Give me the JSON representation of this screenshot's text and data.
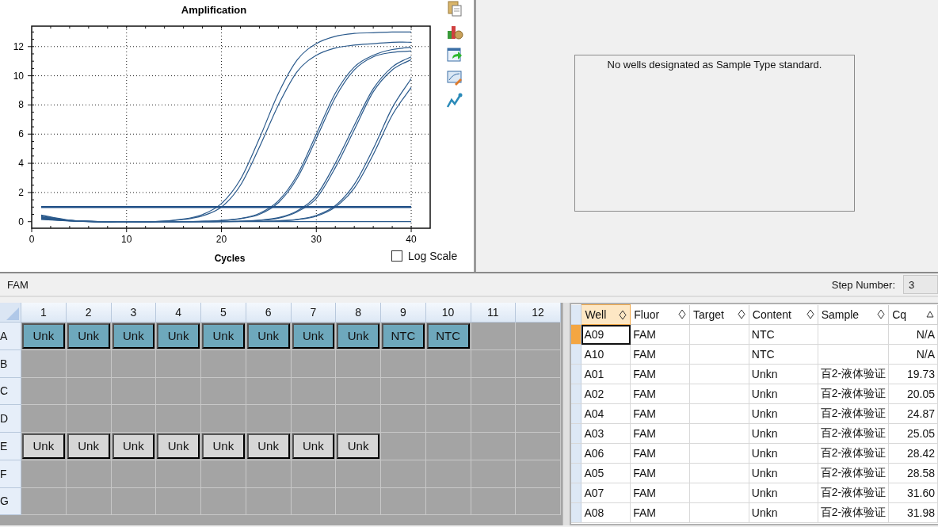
{
  "chart_panel": {
    "chart_data": {
      "type": "line",
      "title": "Amplification",
      "grid": true,
      "xlabel": "Cycles",
      "x": [
        1,
        4,
        7,
        10,
        13,
        16,
        18,
        20,
        22,
        24,
        26,
        28,
        30,
        32,
        34,
        36,
        38,
        40
      ],
      "xlim": [
        0,
        42
      ],
      "ylim": [
        -0.45,
        13.4
      ],
      "xticks": [
        0,
        10,
        20,
        30,
        40
      ],
      "yticks": [
        0,
        2,
        4,
        6,
        8,
        10,
        12
      ],
      "series": [
        {
          "color": "#2b5a8c",
          "values": [
            0.45,
            0.1,
            0,
            0,
            0,
            0.18,
            0.49,
            1.24,
            2.9,
            5.7,
            8.8,
            11.1,
            12.2,
            12.7,
            12.9,
            12.95,
            13,
            13
          ]
        },
        {
          "color": "#2b5a8c",
          "values": [
            0.4,
            0.08,
            0,
            0,
            0,
            0.15,
            0.4,
            1.0,
            2.5,
            5.1,
            8.0,
            10.3,
            11.4,
            11.9,
            12.1,
            12.2,
            12.3,
            12.3
          ]
        },
        {
          "color": "#2b5a8c",
          "values": [
            0.35,
            0.08,
            0,
            0,
            0,
            0,
            0.03,
            0.08,
            0.22,
            0.57,
            1.43,
            3.2,
            6.0,
            8.8,
            10.6,
            11.4,
            11.8,
            11.95
          ]
        },
        {
          "color": "#2b5a8c",
          "values": [
            0.3,
            0.07,
            0,
            0,
            0,
            0,
            0.02,
            0.07,
            0.2,
            0.5,
            1.3,
            3.0,
            5.7,
            8.5,
            10.4,
            11.3,
            11.6,
            11.7
          ]
        },
        {
          "color": "#2b5a8c",
          "values": [
            0.27,
            0.08,
            0,
            0,
            0,
            0,
            0,
            0.01,
            0.04,
            0.1,
            0.27,
            0.75,
            1.8,
            4.0,
            6.6,
            9.1,
            10.6,
            11.3
          ]
        },
        {
          "color": "#2b5a8c",
          "values": [
            0.24,
            0.06,
            0,
            0,
            0,
            0,
            0,
            0.01,
            0.03,
            0.09,
            0.24,
            0.68,
            1.6,
            3.7,
            6.3,
            8.9,
            10.4,
            11.1
          ]
        },
        {
          "color": "#2b5a8c",
          "values": [
            0.21,
            0.07,
            0,
            0,
            0,
            0,
            0,
            0,
            0.01,
            0.02,
            0.06,
            0.16,
            0.43,
            1.1,
            2.56,
            5.0,
            7.8,
            9.8
          ]
        },
        {
          "color": "#2b5a8c",
          "values": [
            0.18,
            0.06,
            0,
            0,
            0,
            0,
            0,
            0,
            0.01,
            0.02,
            0.05,
            0.14,
            0.38,
            1.0,
            2.3,
            4.6,
            7.3,
            9.2
          ]
        },
        {
          "color": "#2b5a8c",
          "values": [
            0.15,
            0.05,
            0,
            0,
            0,
            0,
            0,
            0,
            0,
            0,
            0,
            0,
            0,
            0,
            0,
            0,
            0,
            0
          ]
        }
      ],
      "ref_lines": [
        {
          "axis": "y",
          "value": 1
        }
      ]
    },
    "log_scale": {
      "label": "Log Scale",
      "checked": false
    }
  },
  "standard_curve_panel": {
    "message": "No wells designated as Sample Type standard."
  },
  "fluor_bar": {
    "fluor": "FAM",
    "step_label": "Step Number:",
    "step_value": "3"
  },
  "plate": {
    "columns": [
      "1",
      "2",
      "3",
      "4",
      "5",
      "6",
      "7",
      "8",
      "9",
      "10",
      "11",
      "12"
    ],
    "rows": [
      {
        "label": "A",
        "wells": [
          {
            "kind": "sample",
            "text": "Unk",
            "selected": true
          },
          {
            "kind": "sample",
            "text": "Unk",
            "selected": true
          },
          {
            "kind": "sample",
            "text": "Unk",
            "selected": true
          },
          {
            "kind": "sample",
            "text": "Unk",
            "selected": true
          },
          {
            "kind": "sample",
            "text": "Unk",
            "selected": true
          },
          {
            "kind": "sample",
            "text": "Unk",
            "selected": true
          },
          {
            "kind": "sample",
            "text": "Unk",
            "selected": true
          },
          {
            "kind": "sample",
            "text": "Unk",
            "selected": true
          },
          {
            "kind": "sample",
            "text": "NTC",
            "selected": true
          },
          {
            "kind": "sample",
            "text": "NTC",
            "selected": true
          },
          {
            "kind": "empty"
          },
          {
            "kind": "empty"
          }
        ]
      },
      {
        "label": "B",
        "wells": [
          {
            "kind": "empty"
          },
          {
            "kind": "empty"
          },
          {
            "kind": "empty"
          },
          {
            "kind": "empty"
          },
          {
            "kind": "empty"
          },
          {
            "kind": "empty"
          },
          {
            "kind": "empty"
          },
          {
            "kind": "empty"
          },
          {
            "kind": "empty"
          },
          {
            "kind": "empty"
          },
          {
            "kind": "empty"
          },
          {
            "kind": "empty"
          }
        ]
      },
      {
        "label": "C",
        "wells": [
          {
            "kind": "empty"
          },
          {
            "kind": "empty"
          },
          {
            "kind": "empty"
          },
          {
            "kind": "empty"
          },
          {
            "kind": "empty"
          },
          {
            "kind": "empty"
          },
          {
            "kind": "empty"
          },
          {
            "kind": "empty"
          },
          {
            "kind": "empty"
          },
          {
            "kind": "empty"
          },
          {
            "kind": "empty"
          },
          {
            "kind": "empty"
          }
        ]
      },
      {
        "label": "D",
        "wells": [
          {
            "kind": "empty"
          },
          {
            "kind": "empty"
          },
          {
            "kind": "empty"
          },
          {
            "kind": "empty"
          },
          {
            "kind": "empty"
          },
          {
            "kind": "empty"
          },
          {
            "kind": "empty"
          },
          {
            "kind": "empty"
          },
          {
            "kind": "empty"
          },
          {
            "kind": "empty"
          },
          {
            "kind": "empty"
          },
          {
            "kind": "empty"
          }
        ]
      },
      {
        "label": "E",
        "wells": [
          {
            "kind": "sample",
            "text": "Unk",
            "selected": false
          },
          {
            "kind": "sample",
            "text": "Unk",
            "selected": false
          },
          {
            "kind": "sample",
            "text": "Unk",
            "selected": false
          },
          {
            "kind": "sample",
            "text": "Unk",
            "selected": false
          },
          {
            "kind": "sample",
            "text": "Unk",
            "selected": false
          },
          {
            "kind": "sample",
            "text": "Unk",
            "selected": false
          },
          {
            "kind": "sample",
            "text": "Unk",
            "selected": false
          },
          {
            "kind": "sample",
            "text": "Unk",
            "selected": false
          },
          {
            "kind": "empty"
          },
          {
            "kind": "empty"
          },
          {
            "kind": "empty"
          },
          {
            "kind": "empty"
          }
        ]
      },
      {
        "label": "F",
        "wells": [
          {
            "kind": "empty"
          },
          {
            "kind": "empty"
          },
          {
            "kind": "empty"
          },
          {
            "kind": "empty"
          },
          {
            "kind": "empty"
          },
          {
            "kind": "empty"
          },
          {
            "kind": "empty"
          },
          {
            "kind": "empty"
          },
          {
            "kind": "empty"
          },
          {
            "kind": "empty"
          },
          {
            "kind": "empty"
          },
          {
            "kind": "empty"
          }
        ]
      },
      {
        "label": "G",
        "wells": [
          {
            "kind": "empty"
          },
          {
            "kind": "empty"
          },
          {
            "kind": "empty"
          },
          {
            "kind": "empty"
          },
          {
            "kind": "empty"
          },
          {
            "kind": "empty"
          },
          {
            "kind": "empty"
          },
          {
            "kind": "empty"
          },
          {
            "kind": "empty"
          },
          {
            "kind": "empty"
          },
          {
            "kind": "empty"
          },
          {
            "kind": "empty"
          }
        ]
      }
    ]
  },
  "well_table": {
    "columns": [
      {
        "label": "Well",
        "sorted": false,
        "selected": true
      },
      {
        "label": "Fluor",
        "sorted": false,
        "selected": false
      },
      {
        "label": "Target",
        "sorted": false,
        "selected": false
      },
      {
        "label": "Content",
        "sorted": false,
        "selected": false
      },
      {
        "label": "Sample",
        "sorted": false,
        "selected": false
      },
      {
        "label": "Cq",
        "sorted": true,
        "selected": false
      }
    ],
    "rows": [
      {
        "well": "A09",
        "fluor": "FAM",
        "content": "NTC",
        "cq": "N/A",
        "selected": true
      },
      {
        "well": "A10",
        "fluor": "FAM",
        "content": "NTC",
        "cq": "N/A",
        "selected": false
      },
      {
        "well": "A01",
        "fluor": "FAM",
        "content": "Unkn",
        "sample": "百2-液体验证",
        "cq": "19.73",
        "selected": false
      },
      {
        "well": "A02",
        "fluor": "FAM",
        "content": "Unkn",
        "sample": "百2-液体验证",
        "cq": "20.05",
        "selected": false
      },
      {
        "well": "A04",
        "fluor": "FAM",
        "content": "Unkn",
        "sample": "百2-液体验证",
        "cq": "24.87",
        "selected": false
      },
      {
        "well": "A03",
        "fluor": "FAM",
        "content": "Unkn",
        "sample": "百2-液体验证",
        "cq": "25.05",
        "selected": false
      },
      {
        "well": "A06",
        "fluor": "FAM",
        "content": "Unkn",
        "sample": "百2-液体验证",
        "cq": "28.42",
        "selected": false
      },
      {
        "well": "A05",
        "fluor": "FAM",
        "content": "Unkn",
        "sample": "百2-液体验证",
        "cq": "28.58",
        "selected": false
      },
      {
        "well": "A07",
        "fluor": "FAM",
        "content": "Unkn",
        "sample": "百2-液体验证",
        "cq": "31.60",
        "selected": false
      },
      {
        "well": "A08",
        "fluor": "FAM",
        "content": "Unkn",
        "sample": "百2-液体验证",
        "cq": "31.98",
        "selected": false
      }
    ]
  }
}
